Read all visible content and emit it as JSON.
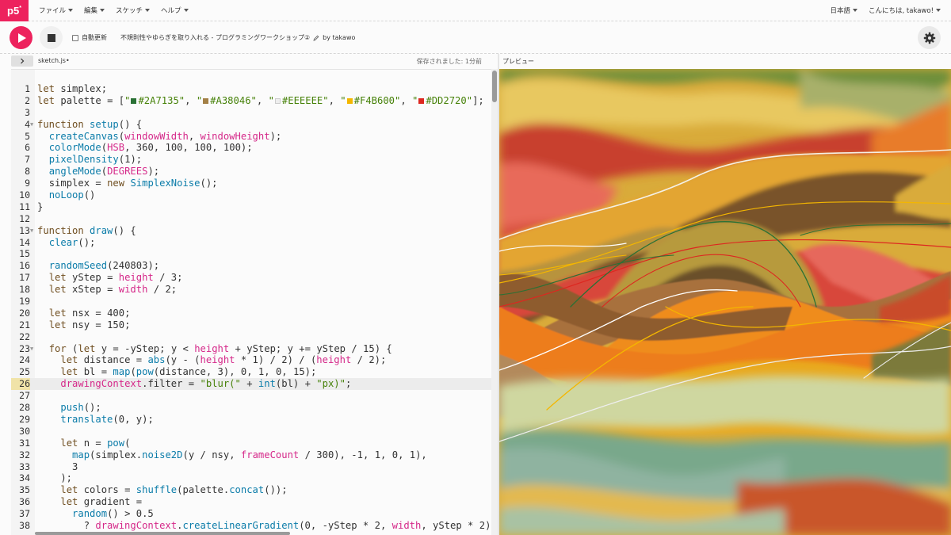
{
  "nav": {
    "logo": "p5",
    "logo_sup": "*",
    "menu": [
      {
        "label": "ファイル"
      },
      {
        "label": "編集"
      },
      {
        "label": "スケッチ"
      },
      {
        "label": "ヘルプ"
      }
    ],
    "language": "日本語",
    "greeting": "こんにちは, takawo!"
  },
  "toolbar": {
    "autorefresh_label": "自動更新",
    "sketch_title": "不規則性やゆらぎを取り入れる - プログラミングワークショップ②",
    "byline": "by takawo"
  },
  "editor": {
    "filename": "sketch.js",
    "unsaved_marker": "•",
    "saved_status": "保存されました: 1分前",
    "active_line": 26
  },
  "preview": {
    "label": "プレビュー"
  },
  "colors": {
    "accent": "#ED225D",
    "palette": [
      "#2A7135",
      "#A38046",
      "#EEEEEE",
      "#F4B600",
      "#DD2720"
    ]
  },
  "code_lines": [
    "let simplex;",
    "let palette = [\"■#2A7135\", \"■#A38046\", \"□#EEEEEE\", \"■#F4B600\", \"■#DD2720\"];",
    "",
    "function setup() {",
    "  createCanvas(windowWidth, windowHeight);",
    "  colorMode(HSB, 360, 100, 100, 100);",
    "  pixelDensity(1);",
    "  angleMode(DEGREES);",
    "  simplex = new SimplexNoise();",
    "  noLoop()",
    "}",
    "",
    "function draw() {",
    "  clear();",
    "",
    "  randomSeed(240803);",
    "  let yStep = height / 3;",
    "  let xStep = width / 2;",
    "",
    "  let nsx = 400;",
    "  let nsy = 150;",
    "",
    "  for (let y = -yStep; y < height + yStep; y += yStep / 15) {",
    "    let distance = abs(y - (height * 1) / 2) / (height / 2);",
    "    let bl = map(pow(distance, 3), 0, 1, 0, 15);",
    "    drawingContext.filter = \"blur(\" + int(bl) + \"px)\";",
    "",
    "    push();",
    "    translate(0, y);",
    "",
    "    let n = pow(",
    "      map(simplex.noise2D(y / nsy, frameCount / 300), -1, 1, 0, 1),",
    "      3",
    "    );",
    "    let colors = shuffle(palette.concat());",
    "    let gradient =",
    "      random() > 0.5",
    "        ? drawingContext.createLinearGradient(0, -yStep * 2, width, yStep * 2)"
  ]
}
